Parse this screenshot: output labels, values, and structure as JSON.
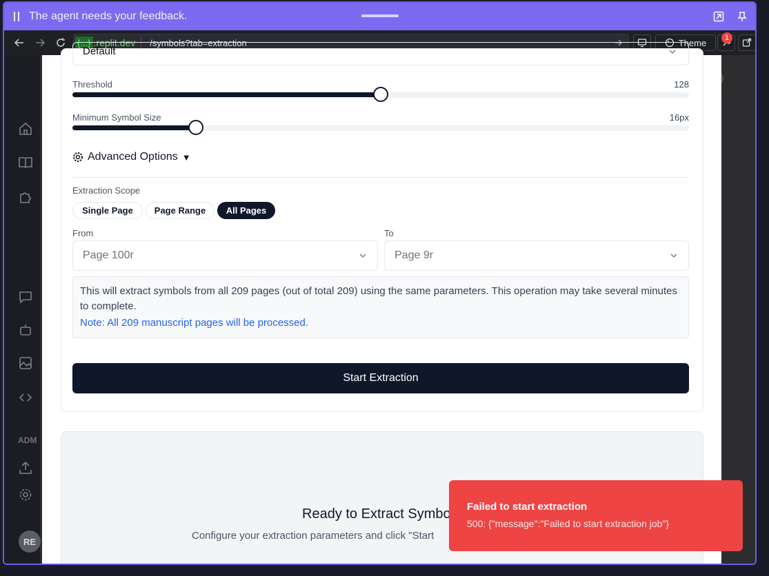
{
  "agent_bar": {
    "message": "The agent needs your feedback."
  },
  "browser": {
    "host_badge": "{...}",
    "host": ".replit.dev",
    "path": "/symbols?tab=extraction",
    "theme_label": "Theme",
    "notification_count": "1"
  },
  "sidebar": {
    "admin_label": "ADM",
    "avatar_initials": "RE"
  },
  "form": {
    "preset_value": "Default",
    "threshold": {
      "label": "Threshold",
      "value_text": "128",
      "value": 128,
      "fraction": 0.5
    },
    "min_symbol_size": {
      "label": "Minimum Symbol Size",
      "value_text": "16px",
      "value": 16,
      "fraction": 0.2
    },
    "advanced_options_label": "Advanced Options",
    "advanced_arrow": "▼",
    "scope": {
      "label": "Extraction Scope",
      "options": [
        "Single Page",
        "Page Range",
        "All Pages"
      ],
      "selected": "All Pages"
    },
    "from": {
      "label": "From",
      "value": "Page 100r"
    },
    "to": {
      "label": "To",
      "value": "Page 9r"
    },
    "info_text": "This will extract symbols from all 209 pages (out of total 209) using the same parameters. This operation may take several minutes to complete.",
    "note_text": "Note: All 209 manuscript pages will be processed.",
    "start_button": "Start Extraction"
  },
  "empty_state": {
    "title": "Ready to Extract Symbo",
    "subtitle": "Configure your extraction parameters and click \"Start"
  },
  "toast": {
    "title": "Failed to start extraction",
    "message": "500: {\"message\":\"Failed to start extraction job\"}"
  },
  "colors": {
    "accent": "#7c6af0",
    "primary": "#0f172a",
    "error": "#ef4444",
    "note": "#2563eb"
  }
}
